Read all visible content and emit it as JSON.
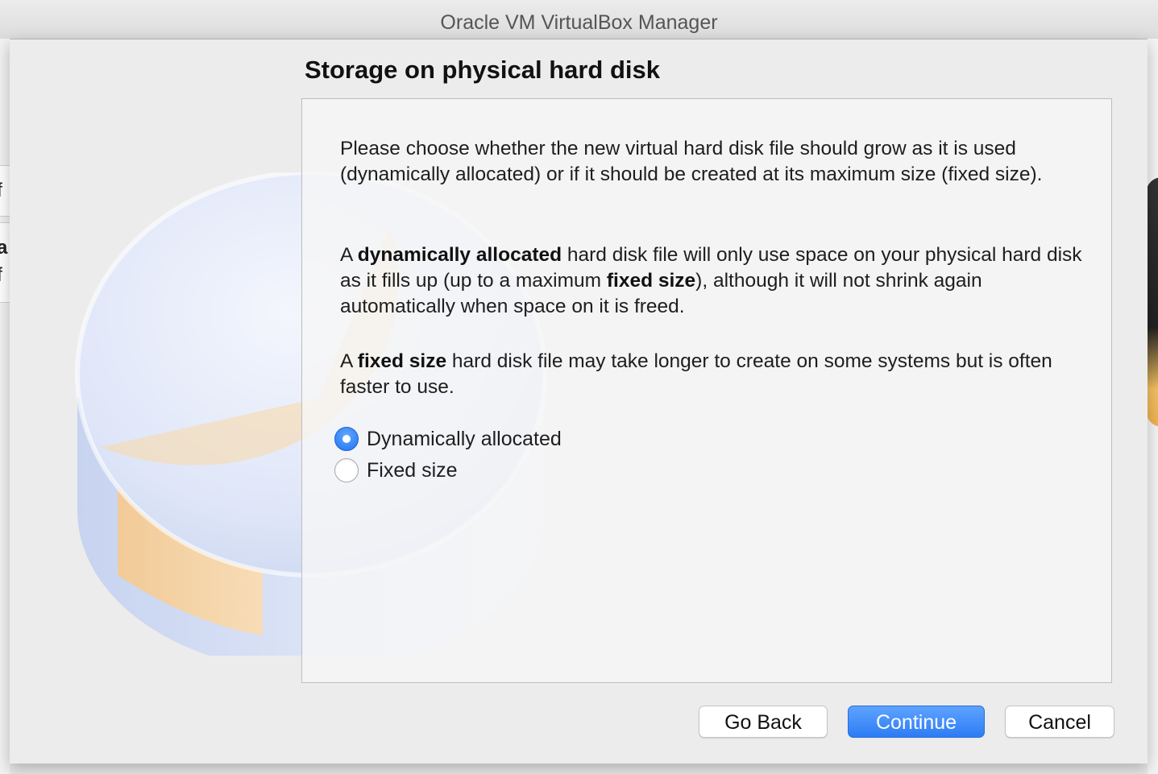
{
  "window": {
    "title": "Oracle VM VirtualBox Manager"
  },
  "background": {
    "left_row_1": "ff",
    "left_row_2_a": "ta",
    "left_row_2_b": "ff"
  },
  "dialog": {
    "heading": "Storage on physical hard disk",
    "intro": "Please choose whether the new virtual hard disk file should grow as it is used (dynamically allocated) or if it should be created at its maximum size (fixed size).",
    "dynamic_para": {
      "p1": "A ",
      "b1": "dynamically allocated",
      "p2": " hard disk file will only use space on your physical hard disk as it fills up (up to a maximum ",
      "b2": "fixed size",
      "p3": "), although it will not shrink again automatically when space on it is freed."
    },
    "fixed_para": {
      "p1": "A ",
      "b1": "fixed size",
      "p2": " hard disk file may take longer to create on some systems but is often faster to use."
    },
    "options": [
      {
        "label": "Dynamically allocated",
        "selected": true
      },
      {
        "label": "Fixed size",
        "selected": false
      }
    ],
    "buttons": {
      "back": "Go Back",
      "continue": "Continue",
      "cancel": "Cancel"
    },
    "colors": {
      "accent": "#2d7cf5",
      "disk_orange": "#f7cf94",
      "disk_blue": "#c9d6f2"
    }
  }
}
